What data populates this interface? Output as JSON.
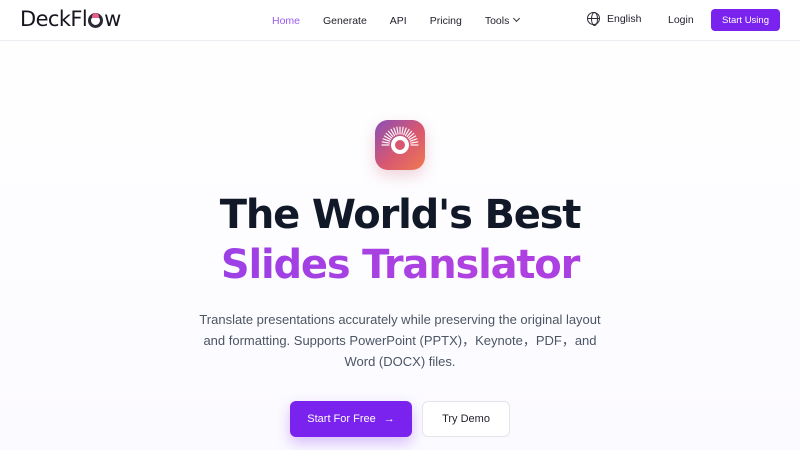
{
  "brand": {
    "logo_prefix": "Deck",
    "logo_mid": "Fl",
    "logo_suffix": "w",
    "accent_color": "#7a22ee"
  },
  "nav": {
    "links": [
      {
        "label": "Home",
        "active": true
      },
      {
        "label": "Generate",
        "active": false
      },
      {
        "label": "API",
        "active": false
      },
      {
        "label": "Pricing",
        "active": false
      },
      {
        "label": "Tools",
        "active": false
      }
    ],
    "language": "English",
    "login_label": "Login",
    "start_label": "Start Using"
  },
  "hero": {
    "icon": "sunburst-app-icon",
    "headline_line1": "The World's Best",
    "headline_line2": "Slides Translator",
    "subtitle_line1": "Translate presentations accurately while preserving the original layout",
    "subtitle_line2": "and formatting. Supports PowerPoint (PPTX)，Keynote，PDF，and",
    "subtitle_line3": "Word (DOCX) files.",
    "primary_cta": "Start For Free",
    "primary_cta_icon": "arrow-right-icon",
    "secondary_cta": "Try Demo"
  }
}
